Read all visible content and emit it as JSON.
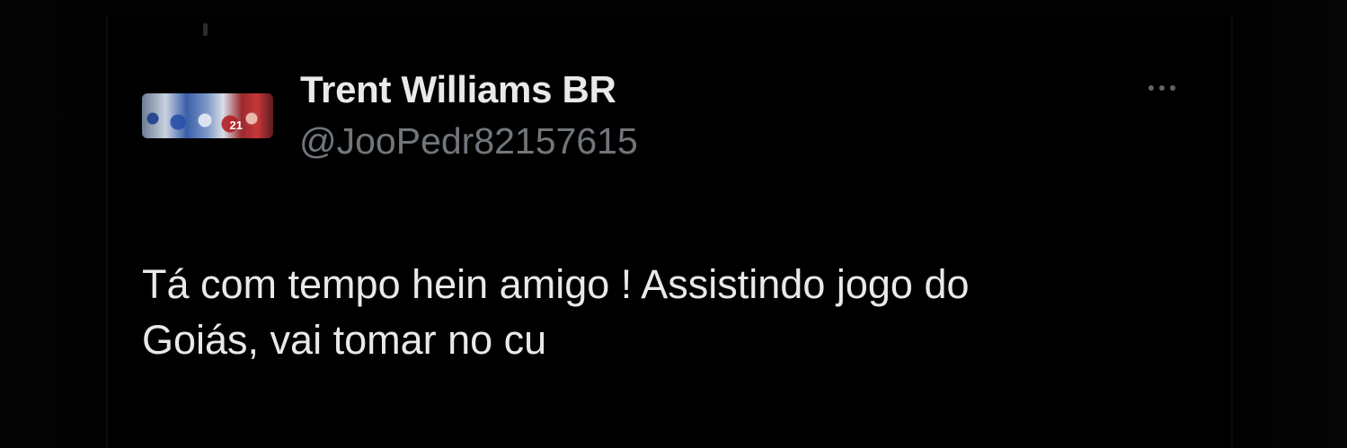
{
  "tweet": {
    "author": {
      "display_name": "Trent Williams BR",
      "handle": "@JooPedr82157615",
      "avatar_icon": "avatar-photo-stadium-player",
      "avatar_jersey_number": "21"
    },
    "text": "Tá com tempo hein amigo ! Assistindo jogo do\nGoiás, vai tomar no cu",
    "more_icon": "more-options-icon"
  },
  "colors": {
    "background": "#000000",
    "primary_text": "#e7e9ea",
    "secondary_text": "#71767b"
  }
}
